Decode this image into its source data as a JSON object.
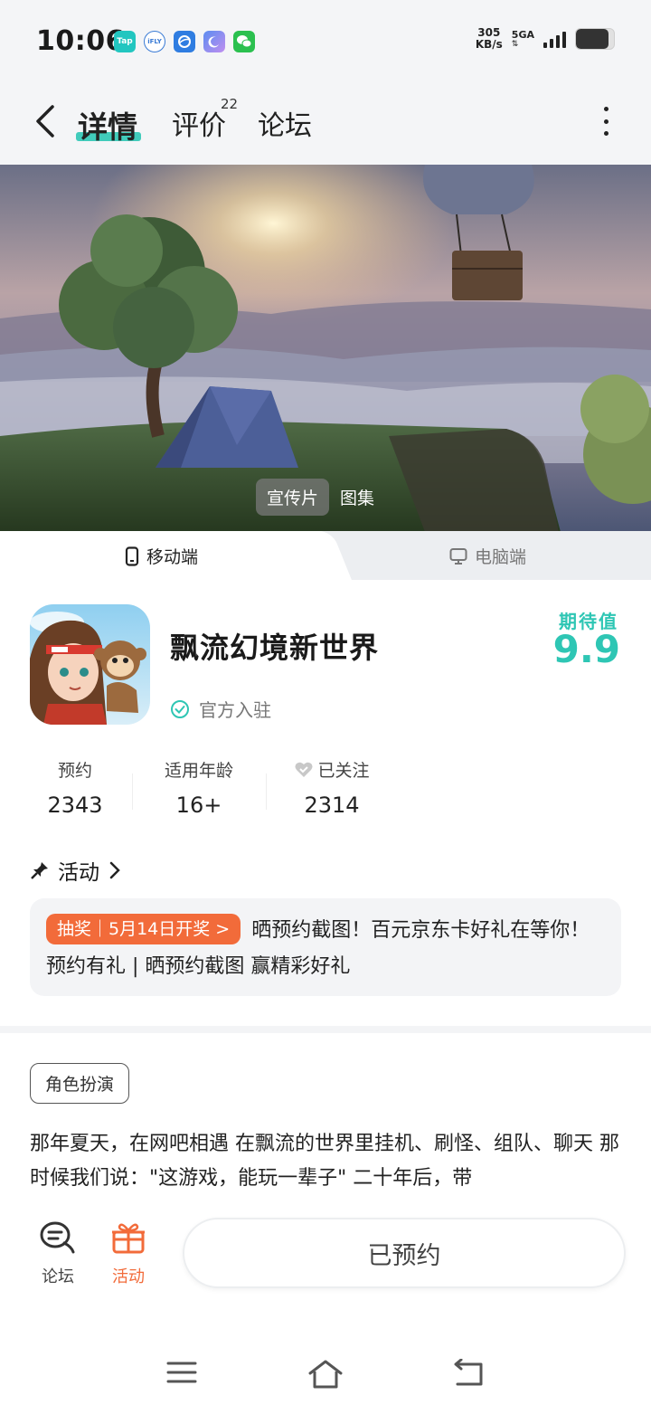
{
  "status_bar": {
    "time": "10:06",
    "net_speed_value": "305",
    "net_speed_unit": "KB/s",
    "net_type": "5GA",
    "notif_icons": [
      "tap-icon",
      "ifly-icon",
      "browser-icon",
      "moon-app-icon",
      "wechat-icon"
    ],
    "battery_level": 0.85
  },
  "header": {
    "tabs": [
      {
        "label": "详情",
        "active": true
      },
      {
        "label": "评价",
        "badge": "22"
      },
      {
        "label": "论坛"
      }
    ]
  },
  "banner": {
    "media_tabs": [
      {
        "label": "宣传片",
        "active": true
      },
      {
        "label": "图集"
      }
    ]
  },
  "platform_tabs": [
    {
      "label": "移动端",
      "active": true
    },
    {
      "label": "电脑端"
    }
  ],
  "game": {
    "title": "飘流幻境新世界",
    "official_label": "官方入驻",
    "expect_label": "期待值",
    "expect_value": "9.9"
  },
  "stats": [
    {
      "label": "预约",
      "value": "2343"
    },
    {
      "label": "适用年龄",
      "value": "16+"
    },
    {
      "label": "已关注",
      "value": "2314",
      "icon": "heart-icon"
    }
  ],
  "activity": {
    "header": "活动",
    "pill": "抽奖｜5月14日开奖 >",
    "text": "晒预约截图！百元京东卡好礼在等你！ 预约有礼 | 晒预约截图 赢精彩好礼"
  },
  "genre_tag": "角色扮演",
  "description": "那年夏天，在网吧相遇 在飘流的世界里挂机、刷怪、组队、聊天 那时候我们说：\"这游戏，能玩一辈子\" 二十年后，带",
  "bottom_bar": {
    "forum_label": "论坛",
    "activity_label": "活动",
    "reserve_label": "已预约"
  },
  "colors": {
    "accent": "#2ec6b4",
    "orange": "#f26b3a"
  }
}
